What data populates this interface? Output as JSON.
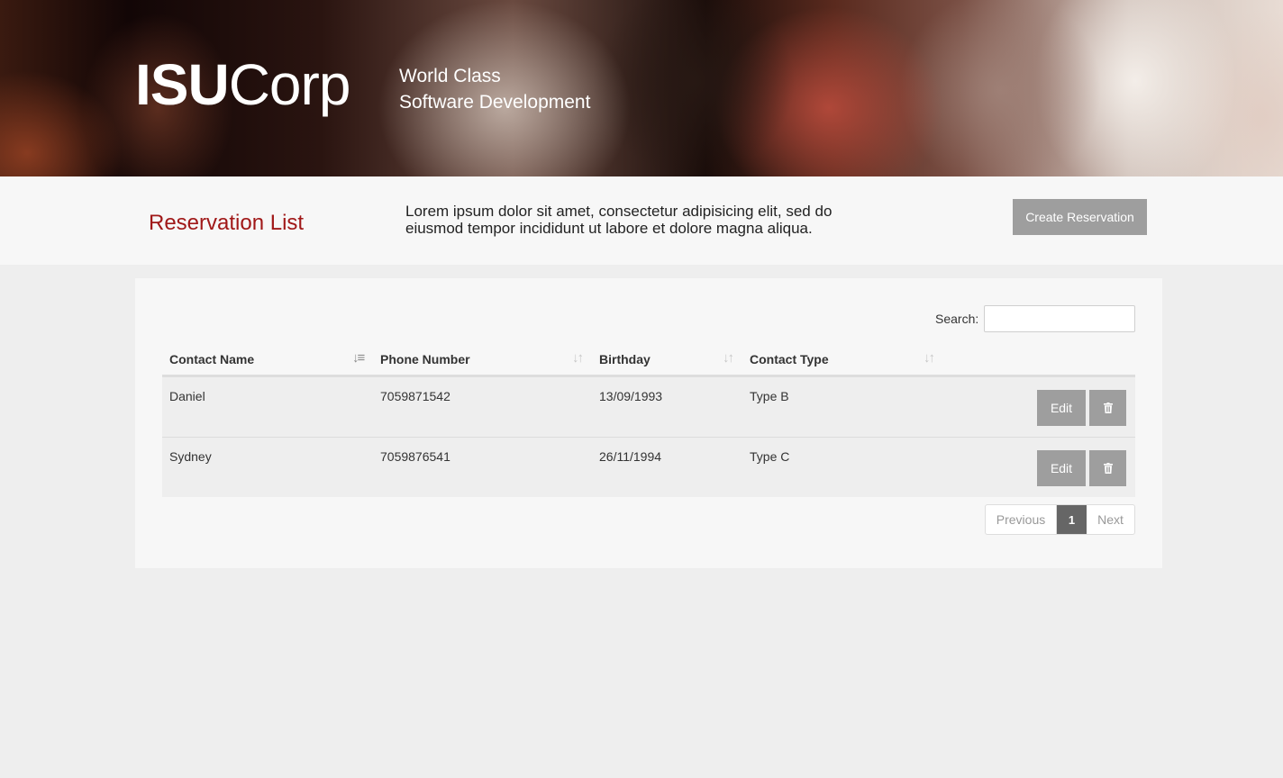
{
  "brand": {
    "logo_bold": "ISU",
    "logo_light": "Corp",
    "tagline_line1": "World Class",
    "tagline_line2": "Software Development"
  },
  "header": {
    "title": "Reservation List",
    "intro_line1": "Lorem ipsum dolor sit amet, consectetur adipisicing elit, sed do",
    "intro_line2": "eiusmod tempor incididunt ut labore et dolore magna aliqua.",
    "create_label": "Create Reservation"
  },
  "search": {
    "label": "Search:",
    "value": ""
  },
  "table": {
    "columns": [
      "Contact Name",
      "Phone Number",
      "Birthday",
      "Contact Type"
    ],
    "rows": [
      {
        "name": "Daniel",
        "phone": "7059871542",
        "birthday": "13/09/1993",
        "type": "Type B",
        "edit_label": "Edit"
      },
      {
        "name": "Sydney",
        "phone": "7059876541",
        "birthday": "26/11/1994",
        "type": "Type C",
        "edit_label": "Edit"
      }
    ]
  },
  "pagination": {
    "previous": "Previous",
    "current": "1",
    "next": "Next"
  },
  "icons": {
    "sort": "sort-icon",
    "sort_active": "sort-ascending-icon",
    "delete": "trash-icon"
  },
  "colors": {
    "title": "#a01818",
    "button": "#9e9e9e",
    "active_page": "#666666"
  }
}
